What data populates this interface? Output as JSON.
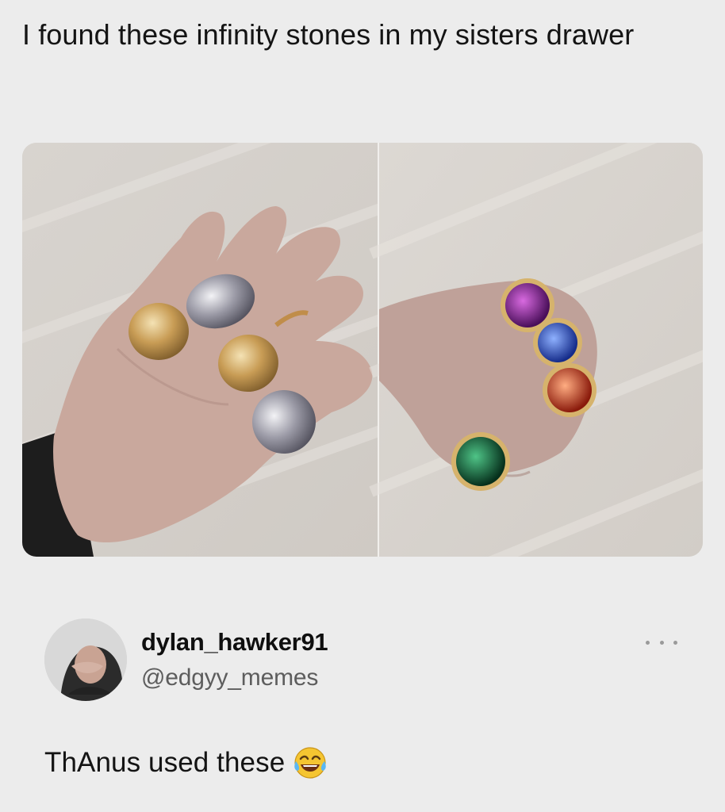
{
  "post": {
    "text": "I found these infinity stones in my sisters drawer"
  },
  "media": {
    "panels": 2,
    "stone_colors": [
      "#7a1e8a",
      "#1f43c8",
      "#d2401e",
      "#0e5a36"
    ]
  },
  "reply": {
    "display_name": "dylan_hawker91",
    "handle": "@edgyy_memes",
    "more_icon": "ellipsis-icon",
    "text": "ThAnus used these",
    "emoji": "face-with-tears-of-joy"
  }
}
